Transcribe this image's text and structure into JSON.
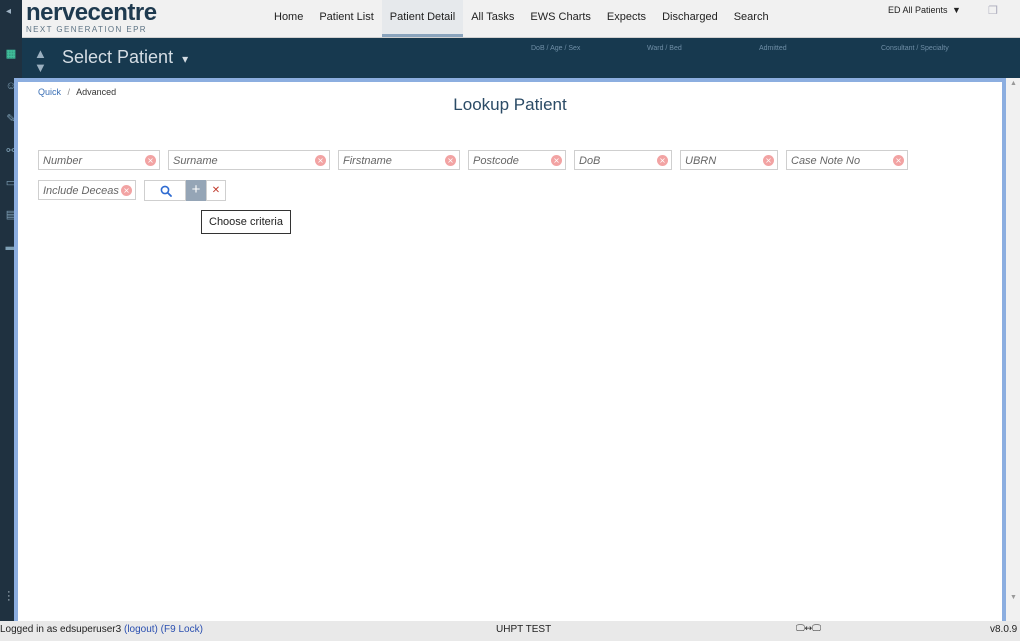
{
  "app": {
    "brand": "nervecentre",
    "tagline": "NEXT GENERATION EPR"
  },
  "nav": {
    "items": [
      {
        "label": "Home"
      },
      {
        "label": "Patient List"
      },
      {
        "label": "Patient Detail",
        "active": true
      },
      {
        "label": "All Tasks"
      },
      {
        "label": "EWS Charts"
      },
      {
        "label": "Expects"
      },
      {
        "label": "Discharged"
      },
      {
        "label": "Search"
      }
    ],
    "ward_select": "ED All Patients",
    "ward_caret": "▼"
  },
  "patient_bar": {
    "title": "Select Patient",
    "dropdown_glyph": "▾",
    "columns": [
      "DoB / Age / Sex",
      "Ward / Bed",
      "Admitted",
      "Consultant / Specialty"
    ]
  },
  "modal": {
    "breadcrumb": {
      "quick": "Quick",
      "separator": "/",
      "current": "Advanced"
    },
    "title": "Lookup Patient",
    "fields": {
      "number": "Number",
      "surname": "Surname",
      "firstname": "Firstname",
      "postcode": "Postcode",
      "dob": "DoB",
      "ubrn": "UBRN",
      "case_note_no": "Case Note No",
      "include_deceased": "Include Deceased"
    },
    "clear_glyph": "×",
    "add_glyph": "+",
    "remove_glyph": "✕",
    "tooltip": "Choose criteria"
  },
  "footer": {
    "login_prefix": "Logged in as edsuperuser3",
    "logout": "(logout)",
    "lock": "(F9 Lock)",
    "environment": "UHPT TEST",
    "screens_glyph": "🖵↔🖵",
    "version": "v8.0.9"
  },
  "colors": {
    "nav_dark": "#1f3140",
    "patient_bar": "#17394f",
    "modal_border": "#8caee0",
    "clear_icon": "#f2a3a3",
    "add_button": "#95a5b6",
    "link": "#3a6fb5"
  }
}
